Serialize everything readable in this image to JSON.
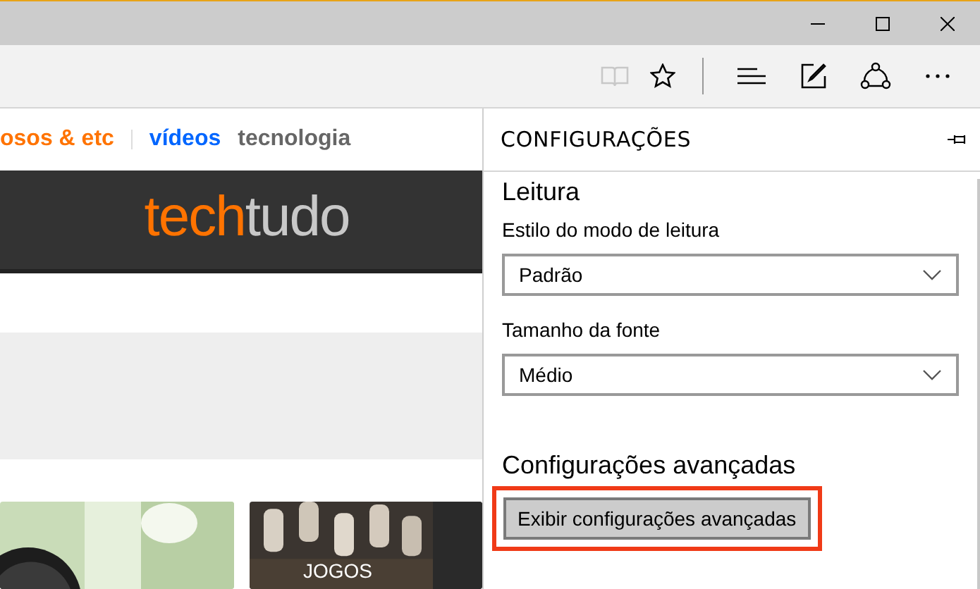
{
  "page": {
    "nav": [
      {
        "label": "osos & etc",
        "color": "#ff7300"
      },
      {
        "label": "vídeos",
        "color": "#0066ff"
      },
      {
        "label": "tecnologia",
        "color": "#666666"
      }
    ],
    "logo": {
      "part_1": "tech",
      "part_2": "tudo"
    },
    "tiles": [
      {
        "kind": "picture"
      },
      {
        "kind": "picture",
        "label": "JOGOS"
      }
    ]
  },
  "settings": {
    "title": "CONFIGURAÇÕES",
    "section": "Leitura",
    "fields": [
      {
        "label": "Estilo do modo de leitura",
        "value": "Padrão"
      },
      {
        "label": "Tamanho da fonte",
        "value": "Médio"
      }
    ],
    "advanced": {
      "title": "Configurações avançadas",
      "button": "Exibir configurações avançadas",
      "highlighted": true
    }
  }
}
